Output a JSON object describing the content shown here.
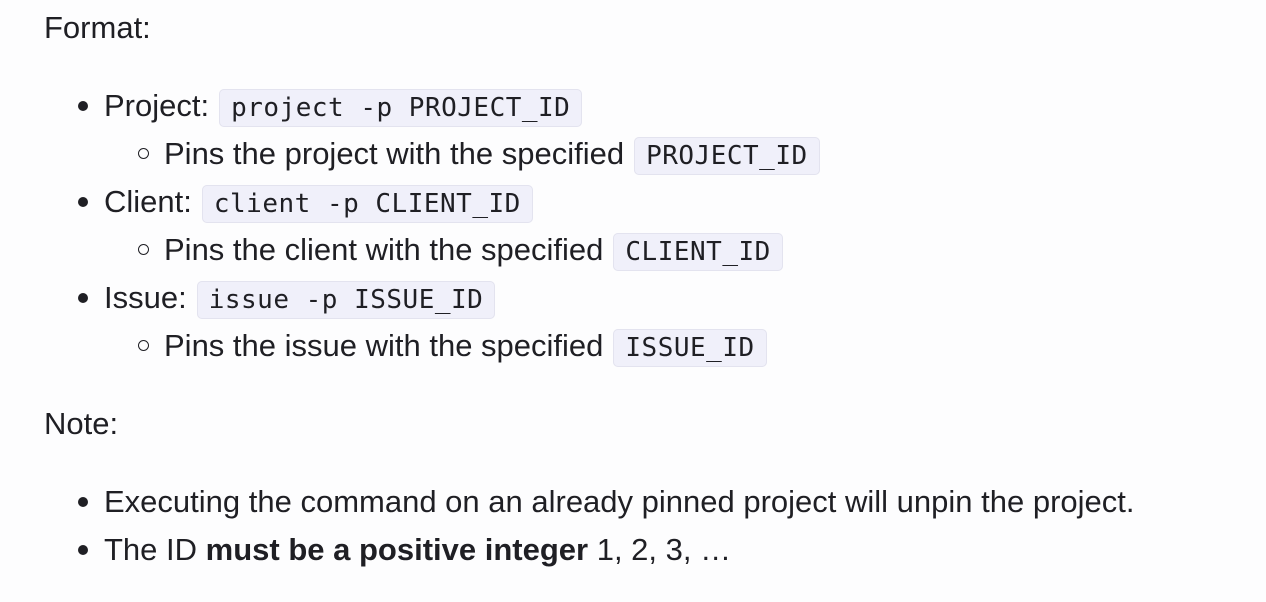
{
  "format_heading": "Format:",
  "format_items": [
    {
      "label": "Project:",
      "command": "project -p PROJECT_ID",
      "description": "Pins the project with the specified",
      "description_code": "PROJECT_ID"
    },
    {
      "label": "Client:",
      "command": "client -p CLIENT_ID",
      "description": "Pins the client with the specified",
      "description_code": "CLIENT_ID"
    },
    {
      "label": "Issue:",
      "command": "issue -p ISSUE_ID",
      "description": "Pins the issue with the specified",
      "description_code": "ISSUE_ID"
    }
  ],
  "note_heading": "Note:",
  "note_items": [
    {
      "text": "Executing the command on an already pinned project will unpin the project."
    },
    {
      "text_before": "The ID ",
      "bold": "must be a positive integer",
      "text_after": " 1, 2, 3, …"
    }
  ]
}
